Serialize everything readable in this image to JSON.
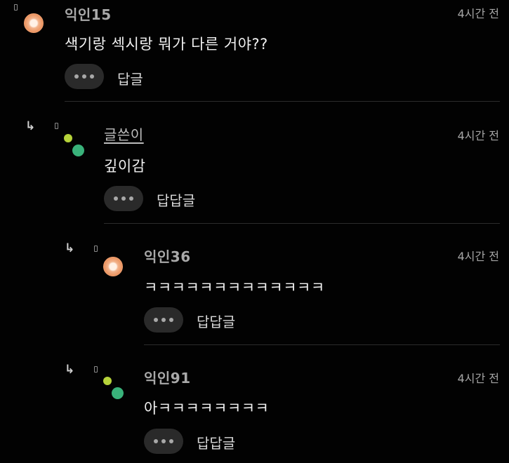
{
  "comments": [
    {
      "name": "익인15",
      "time": "4시간 전",
      "text": "색기랑 섹시랑 뭐가 다른 거야??",
      "reply": "답글"
    },
    {
      "name": "글쓴이",
      "time": "4시간 전",
      "text": "깊이감",
      "reply": "답답글"
    },
    {
      "name": "익인36",
      "time": "4시간 전",
      "text": "ㅋㅋㅋㅋㅋㅋㅋㅋㅋㅋㅋㅋㅋ",
      "reply": "답답글"
    },
    {
      "name": "익인91",
      "time": "4시간 전",
      "text": "아ㅋㅋㅋㅋㅋㅋㅋㅋ",
      "reply": "답답글"
    }
  ],
  "icons": {
    "reply_arrow": "reply-arrow-icon",
    "flag": "flag-icon",
    "more": "more-options-icon"
  }
}
